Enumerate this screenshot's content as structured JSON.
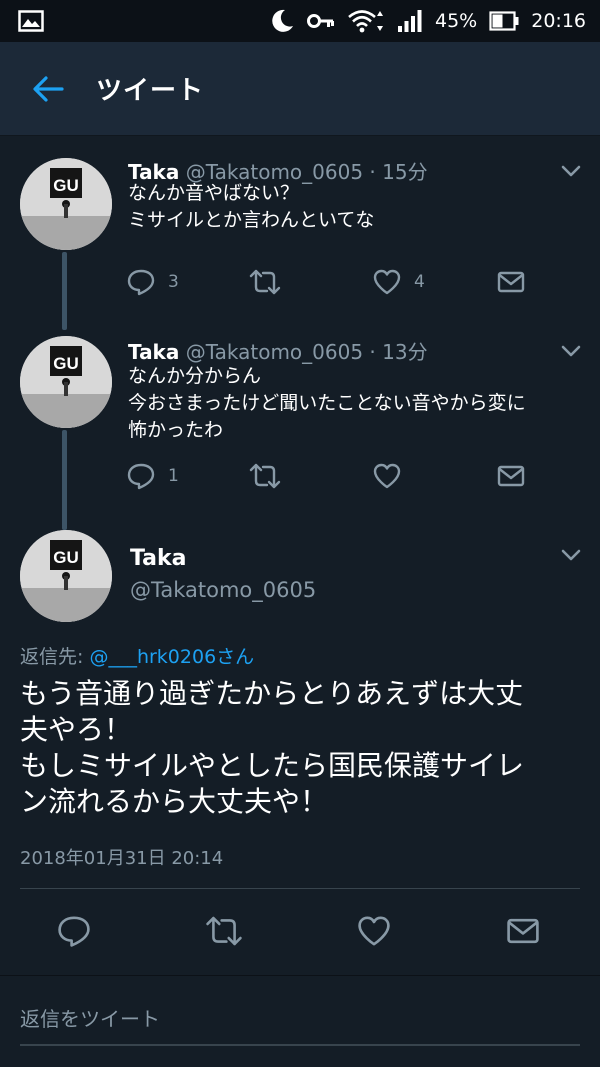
{
  "status_bar": {
    "battery": "45%",
    "time": "20:16"
  },
  "app_bar": {
    "title": "ツイート"
  },
  "thread": [
    {
      "name": "Taka",
      "handle": "@Takatomo_0605",
      "time": "15分",
      "text_lines": [
        "なんか音やばない？",
        "ミサイルとか言わんといてな"
      ],
      "reply_count": "3",
      "retweet_count": "",
      "like_count": "4",
      "avatar_label": "GU"
    },
    {
      "name": "Taka",
      "handle": "@Takatomo_0605",
      "time": "13分",
      "text_lines": [
        "なんか分からん",
        "今おさまったけど聞いたことない音やから変に",
        "怖かったわ"
      ],
      "reply_count": "1",
      "retweet_count": "",
      "like_count": "",
      "avatar_label": "GU"
    }
  ],
  "main_tweet": {
    "name": "Taka",
    "handle": "@Takatomo_0605",
    "avatar_label": "GU",
    "reply_to_prefix": "返信先: ",
    "reply_to_mention": "@___hrk0206さん",
    "text_lines": [
      "もう音通り過ぎたからとりあえずは大丈",
      "夫やろ！",
      "もしミサイルやとしたら国民保護サイレ",
      "ン流れるから大丈夫や！"
    ],
    "date": "2018年01月31日 20:14"
  },
  "reply_box": {
    "placeholder": "返信をツイート"
  },
  "colors": {
    "background": "#141d26",
    "app_bar": "#1c2938",
    "accent": "#1da1f2",
    "secondary_text": "#8899a6"
  }
}
